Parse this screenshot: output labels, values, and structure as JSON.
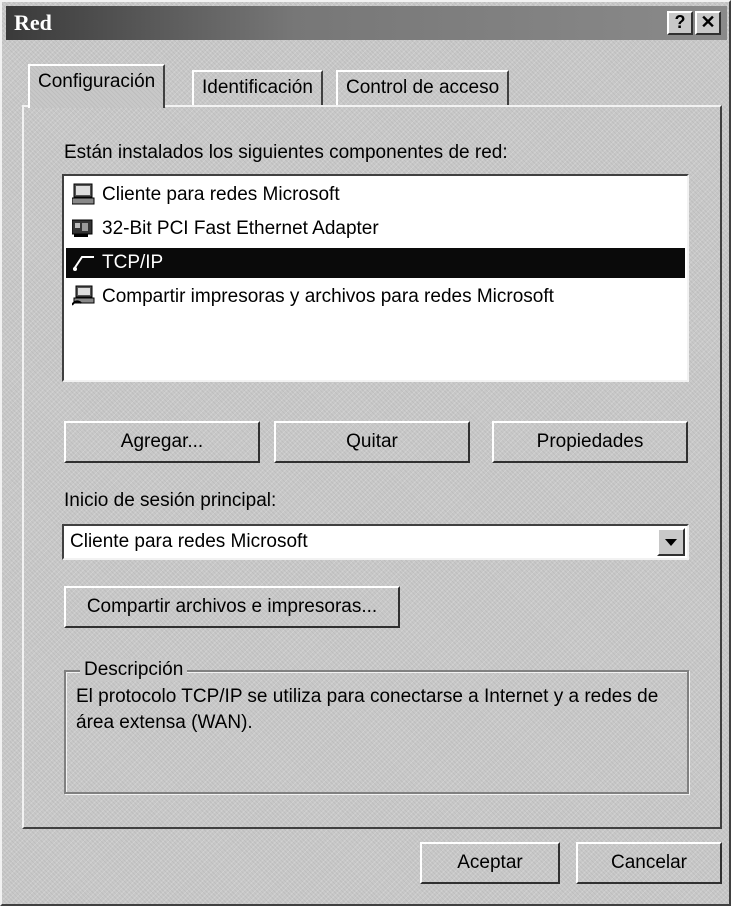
{
  "window": {
    "title": "Red",
    "help_button": "?",
    "close_button": "✕"
  },
  "tabs": [
    {
      "label": "Configuración"
    },
    {
      "label": "Identificación"
    },
    {
      "label": "Control de acceso"
    }
  ],
  "components": {
    "label": "Están instalados los siguientes componentes de red:",
    "items": [
      {
        "label": "Cliente para redes Microsoft",
        "icon": "computer-icon"
      },
      {
        "label": "32-Bit PCI Fast Ethernet Adapter",
        "icon": "network-card-icon"
      },
      {
        "label": "TCP/IP",
        "icon": "protocol-icon",
        "selected": true
      },
      {
        "label": "Compartir impresoras y archivos para redes Microsoft",
        "icon": "share-icon"
      }
    ]
  },
  "buttons": {
    "add": "Agregar...",
    "remove": "Quitar",
    "properties": "Propiedades",
    "share_files": "Compartir archivos e impresoras...",
    "ok": "Aceptar",
    "cancel": "Cancelar"
  },
  "logon": {
    "label": "Inicio de sesión principal:",
    "value": "Cliente para redes Microsoft"
  },
  "description": {
    "legend": "Descripción",
    "text": "El protocolo TCP/IP se utiliza para conectarse a Internet y a redes de área extensa (WAN)."
  },
  "colors": {
    "selection": "#0a0a0a",
    "face": "#c8c8c8",
    "titlebar_dark": "#3a3a3a"
  }
}
